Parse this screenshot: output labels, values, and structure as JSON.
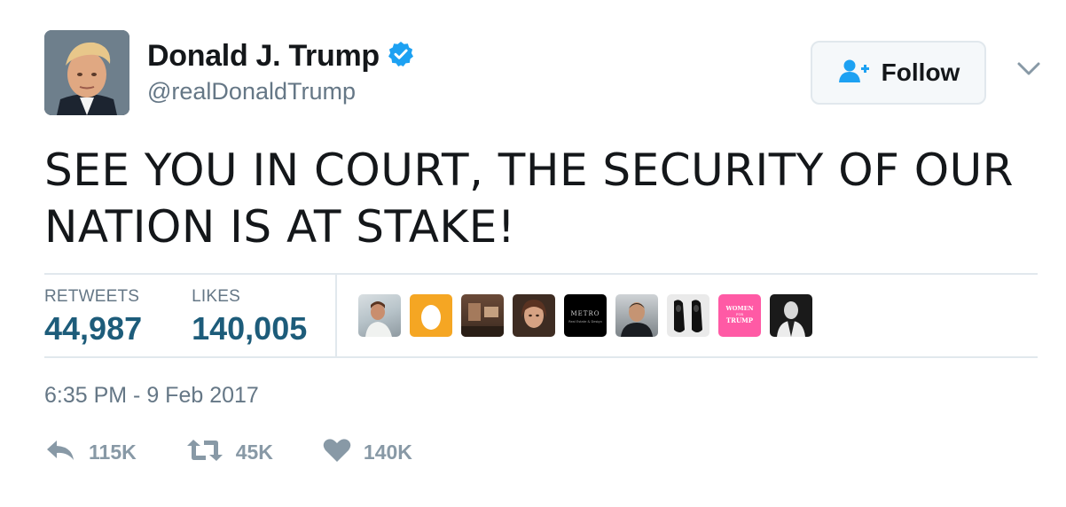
{
  "author": {
    "name": "Donald J. Trump",
    "handle": "@realDonaldTrump",
    "verified": true,
    "avatar_icon": "profile-photo"
  },
  "follow_button": {
    "label": "Follow",
    "icon": "add-user-icon"
  },
  "menu": {
    "icon": "chevron-down-icon"
  },
  "tweet": {
    "text": "SEE YOU IN COURT, THE SECURITY OF OUR NATION IS AT STAKE!"
  },
  "stats": {
    "retweets_label": "RETWEETS",
    "retweets_value": "44,987",
    "likes_label": "LIKES",
    "likes_value": "140,005"
  },
  "likers": [
    {
      "name": "liker-1"
    },
    {
      "name": "liker-2-egg"
    },
    {
      "name": "liker-3"
    },
    {
      "name": "liker-4"
    },
    {
      "name": "liker-5-metro",
      "text": "METRO",
      "subtext": "Real Estate & Design"
    },
    {
      "name": "liker-6"
    },
    {
      "name": "liker-7-shoes"
    },
    {
      "name": "liker-8-women-for-trump",
      "text_top": "WOMEN",
      "text_mid": "FOR",
      "text_bottom": "TRUMP"
    },
    {
      "name": "liker-9"
    }
  ],
  "timestamp": "6:35 PM - 9 Feb 2017",
  "actions": {
    "reply_count": "115K",
    "retweet_count": "45K",
    "like_count": "140K"
  },
  "colors": {
    "verified": "#1da1f2",
    "link_blue": "#1d5c7a",
    "muted": "#657786",
    "icon_gray": "#8899a6",
    "border": "#e1e8ed"
  }
}
